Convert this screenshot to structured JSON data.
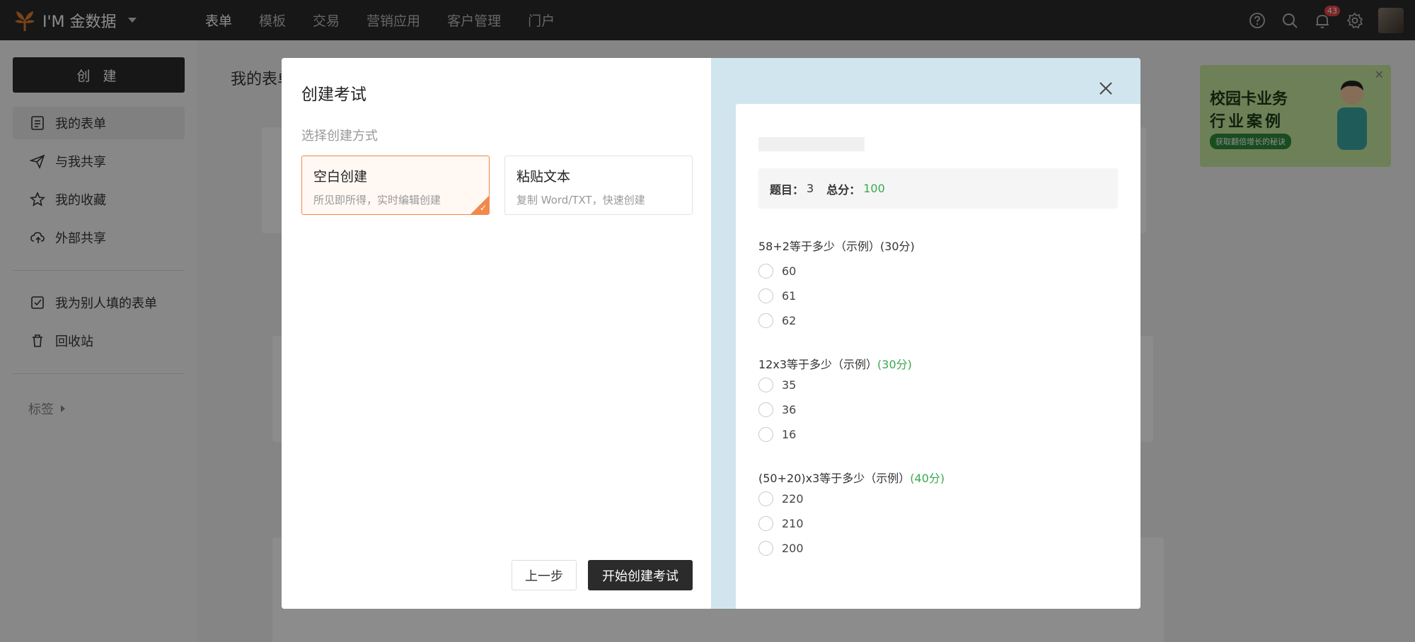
{
  "topbar": {
    "brand": "I'M 金数据",
    "nav": [
      "表单",
      "模板",
      "交易",
      "营销应用",
      "客户管理",
      "门户"
    ],
    "active_nav": "表单",
    "notification_count": "43"
  },
  "sidebar": {
    "create_label": "创 建",
    "items": [
      {
        "label": "我的表单",
        "icon": "form-icon"
      },
      {
        "label": "与我共享",
        "icon": "send-icon"
      },
      {
        "label": "我的收藏",
        "icon": "star-icon"
      },
      {
        "label": "外部共享",
        "icon": "cloud-share-icon"
      },
      {
        "label": "我为别人填的表单",
        "icon": "checkbox-icon"
      },
      {
        "label": "回收站",
        "icon": "trash-icon"
      }
    ],
    "tags_label": "标签"
  },
  "main": {
    "title": "我的表单"
  },
  "ad": {
    "line1": "校园卡业务",
    "line2": "行业案例",
    "tag": "获取翻倍增长的秘诀"
  },
  "modal": {
    "title": "创建考试",
    "subtitle": "选择创建方式",
    "options": [
      {
        "title": "空白创建",
        "desc": "所见即所得，实时编辑创建",
        "selected": true
      },
      {
        "title": "粘贴文本",
        "desc": "复制 Word/TXT，快速创建",
        "selected": false
      }
    ],
    "prev_button": "上一步",
    "start_button": "开始创建考试",
    "preview": {
      "question_count_label": "题目：",
      "question_count": "3",
      "total_score_label": "总分：",
      "total_score": "100",
      "questions": [
        {
          "title": "58+2等于多少（示例）(30分)",
          "score": "",
          "options": [
            "60",
            "61",
            "62"
          ]
        },
        {
          "title": "12x3等于多少（示例）",
          "score": "(30分)",
          "options": [
            "35",
            "36",
            "16"
          ]
        },
        {
          "title": "(50+20)x3等于多少（示例）",
          "score": "(40分)",
          "options": [
            "220",
            "210",
            "200"
          ]
        }
      ]
    }
  },
  "colors": {
    "accent_orange": "#ef8a4a",
    "score_green": "#39a94f",
    "dark": "#2b2b2b",
    "preview_bg": "#d1e5ee"
  }
}
